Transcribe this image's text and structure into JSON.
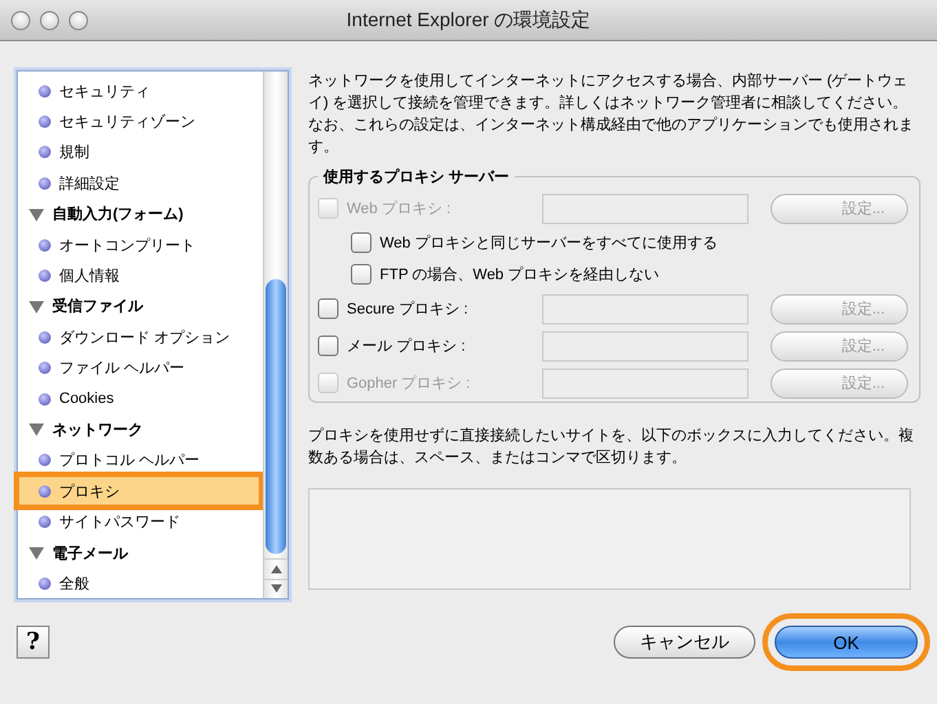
{
  "window": {
    "title": "Internet Explorer の環境設定"
  },
  "sidebar": {
    "items": [
      {
        "kind": "item",
        "label": "セキュリティ",
        "selected": false,
        "highlighted": false
      },
      {
        "kind": "item",
        "label": "セキュリティゾーン",
        "selected": false,
        "highlighted": false
      },
      {
        "kind": "item",
        "label": "規制",
        "selected": false,
        "highlighted": false
      },
      {
        "kind": "item",
        "label": "詳細設定",
        "selected": false,
        "highlighted": false
      },
      {
        "kind": "group",
        "label": "自動入力(フォーム)",
        "expanded": true,
        "children": [
          {
            "kind": "item",
            "label": "オートコンプリート",
            "selected": false,
            "highlighted": false
          },
          {
            "kind": "item",
            "label": "個人情報",
            "selected": false,
            "highlighted": false
          }
        ]
      },
      {
        "kind": "group",
        "label": "受信ファイル",
        "expanded": true,
        "children": [
          {
            "kind": "item",
            "label": "ダウンロード オプション",
            "selected": false,
            "highlighted": false
          },
          {
            "kind": "item",
            "label": "ファイル ヘルパー",
            "selected": false,
            "highlighted": false
          },
          {
            "kind": "item",
            "label": "Cookies",
            "selected": false,
            "highlighted": false
          }
        ]
      },
      {
        "kind": "group",
        "label": "ネットワーク",
        "expanded": true,
        "children": [
          {
            "kind": "item",
            "label": "プロトコル ヘルパー",
            "selected": false,
            "highlighted": false
          },
          {
            "kind": "item",
            "label": "プロキシ",
            "selected": true,
            "highlighted": true
          },
          {
            "kind": "item",
            "label": "サイトパスワード",
            "selected": false,
            "highlighted": false
          }
        ]
      },
      {
        "kind": "group",
        "label": "電子メール",
        "expanded": true,
        "children": [
          {
            "kind": "item",
            "label": "全般",
            "selected": false,
            "highlighted": false
          }
        ]
      }
    ]
  },
  "panel": {
    "description": "ネットワークを使用してインターネットにアクセスする場合、内部サーバー (ゲートウェイ) を選択して接続を管理できます。詳しくはネットワーク管理者に相談してください。なお、これらの設定は、インターネット構成経由で他のアプリケーションでも使用されます。",
    "proxy_group": {
      "title": "使用するプロキシ サーバー",
      "rows": [
        {
          "kind": "proxy",
          "label": "Web プロキシ :",
          "checked": false,
          "disabled": true,
          "button": "設定...",
          "button_disabled": true
        },
        {
          "kind": "option",
          "label": "Web プロキシと同じサーバーをすべてに使用する",
          "checked": false,
          "disabled": false
        },
        {
          "kind": "option",
          "label": "FTP の場合、Web プロキシを経由しない",
          "checked": false,
          "disabled": false
        },
        {
          "kind": "proxy",
          "label": "Secure プロキシ :",
          "checked": false,
          "disabled": false,
          "button": "設定...",
          "button_disabled": true
        },
        {
          "kind": "proxy",
          "label": "メール プロキシ :",
          "checked": false,
          "disabled": false,
          "button": "設定...",
          "button_disabled": true
        },
        {
          "kind": "proxy",
          "label": "Gopher プロキシ :",
          "checked": false,
          "disabled": true,
          "button": "設定...",
          "button_disabled": true
        }
      ]
    },
    "bypass_note": "プロキシを使用せずに直接接続したいサイトを、以下のボックスに入力してください。複数ある場合は、スペース、またはコンマで区切ります。"
  },
  "footer": {
    "help": "?",
    "buttons": [
      {
        "kind": "normal",
        "label": "キャンセル",
        "highlighted": false
      },
      {
        "kind": "default",
        "label": "OK",
        "highlighted": true
      }
    ]
  }
}
